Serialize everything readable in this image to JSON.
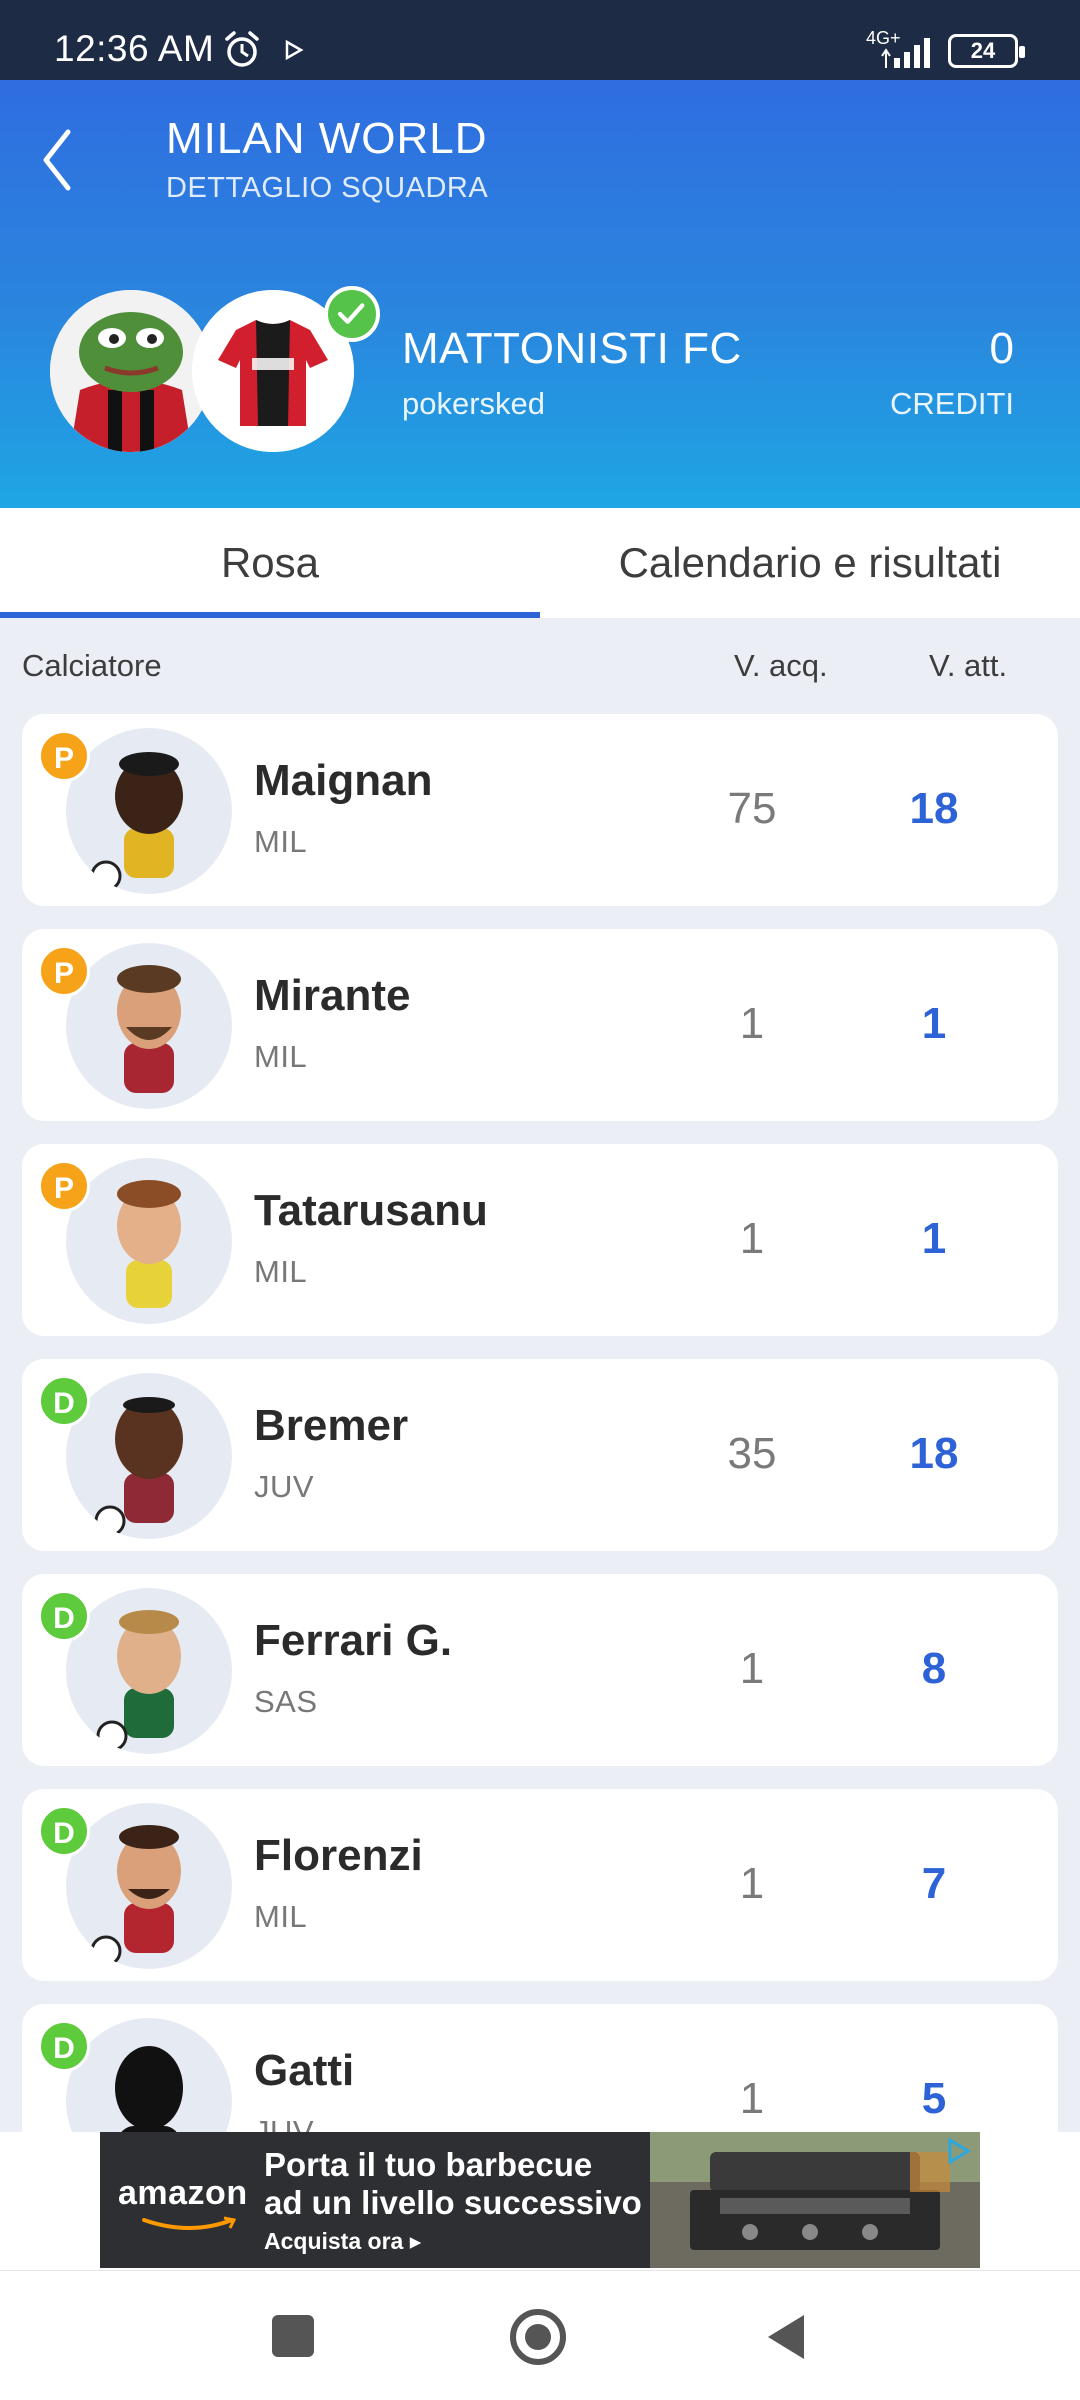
{
  "status_bar": {
    "time": "12:36 AM",
    "network": "4G+",
    "battery": "24"
  },
  "header": {
    "title": "MILAN WORLD",
    "subtitle": "DETTAGLIO SQUADRA",
    "team_name": "MATTONISTI FC",
    "owner": "pokersked",
    "credits_value": "0",
    "credits_label": "CREDITI"
  },
  "tabs": [
    {
      "label": "Rosa",
      "active": true
    },
    {
      "label": "Calendario e risultati",
      "active": false
    }
  ],
  "columns": {
    "player": "Calciatore",
    "purchase_value": "V. acq.",
    "current_value": "V. att."
  },
  "players": [
    {
      "role": "P",
      "name": "Maignan",
      "team": "MIL",
      "acq": "75",
      "att": "18"
    },
    {
      "role": "P",
      "name": "Mirante",
      "team": "MIL",
      "acq": "1",
      "att": "1"
    },
    {
      "role": "P",
      "name": "Tatarusanu",
      "team": "MIL",
      "acq": "1",
      "att": "1"
    },
    {
      "role": "D",
      "name": "Bremer",
      "team": "JUV",
      "acq": "35",
      "att": "18"
    },
    {
      "role": "D",
      "name": "Ferrari G.",
      "team": "SAS",
      "acq": "1",
      "att": "8"
    },
    {
      "role": "D",
      "name": "Florenzi",
      "team": "MIL",
      "acq": "1",
      "att": "7"
    },
    {
      "role": "D",
      "name": "Gatti",
      "team": "JUV",
      "acq": "1",
      "att": "5"
    }
  ],
  "ad": {
    "brand": "amazon",
    "line1": "Porta il tuo barbecue",
    "line2": "ad un livello successivo",
    "cta": "Acquista ora ▸"
  },
  "colors": {
    "accent": "#2d63d6",
    "header_top": "#2f6de0",
    "header_bottom": "#1ea6e4",
    "role_P": "#f6a319",
    "role_D": "#5ecb3c"
  },
  "icons": {
    "back": "chevron-left-icon",
    "verified": "check-icon",
    "alarm": "alarm-clock-icon",
    "nav_recent": "square-icon",
    "nav_home": "circle-icon",
    "nav_back": "triangle-back-icon"
  }
}
